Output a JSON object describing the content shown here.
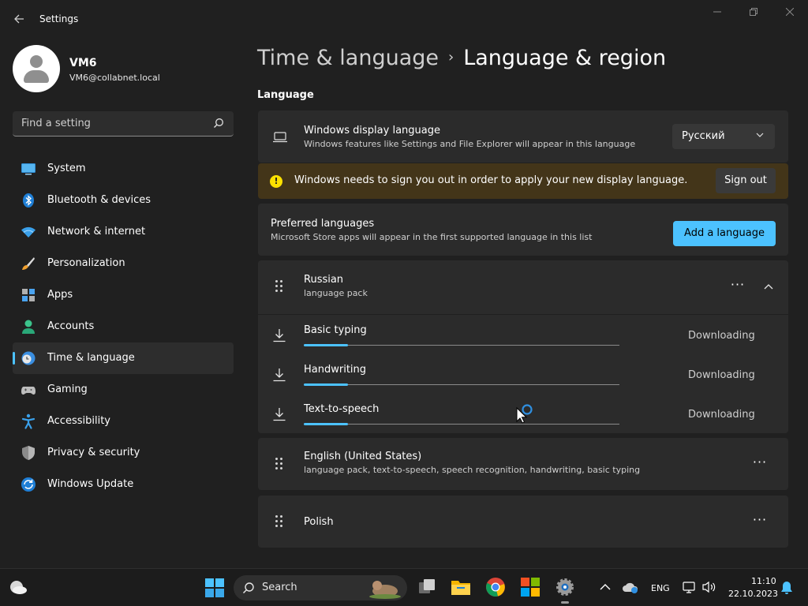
{
  "window": {
    "title": "Settings"
  },
  "profile": {
    "name": "VM6",
    "email": "VM6@collabnet.local"
  },
  "search": {
    "placeholder": "Find a setting"
  },
  "nav": {
    "items": [
      {
        "label": "System",
        "icon": "monitor-icon"
      },
      {
        "label": "Bluetooth & devices",
        "icon": "bluetooth-icon"
      },
      {
        "label": "Network & internet",
        "icon": "wifi-icon"
      },
      {
        "label": "Personalization",
        "icon": "paintbrush-icon"
      },
      {
        "label": "Apps",
        "icon": "apps-icon"
      },
      {
        "label": "Accounts",
        "icon": "person-icon"
      },
      {
        "label": "Time & language",
        "icon": "clock-globe-icon",
        "selected": true
      },
      {
        "label": "Gaming",
        "icon": "gamepad-icon"
      },
      {
        "label": "Accessibility",
        "icon": "accessibility-icon"
      },
      {
        "label": "Privacy & security",
        "icon": "shield-icon"
      },
      {
        "label": "Windows Update",
        "icon": "update-icon"
      }
    ]
  },
  "breadcrumb": {
    "parent": "Time & language",
    "separator": "›",
    "current": "Language & region"
  },
  "language": {
    "section_title": "Language",
    "display_language": {
      "title": "Windows display language",
      "subtitle": "Windows features like Settings and File Explorer will appear in this language",
      "selected": "Русский"
    },
    "warning": {
      "text": "Windows needs to sign you out in order to apply your new display language.",
      "icon_glyph": "!",
      "button": "Sign out"
    },
    "preferred": {
      "title": "Preferred languages",
      "subtitle": "Microsoft Store apps will appear in the first supported language in this list",
      "add_button": "Add a language"
    },
    "languages": [
      {
        "name": "Russian",
        "detail": "language pack",
        "more": "···",
        "expanded": true,
        "features": [
          {
            "label": "Basic typing",
            "status": "Downloading",
            "progress": 0.14
          },
          {
            "label": "Handwriting",
            "status": "Downloading",
            "progress": 0.14
          },
          {
            "label": "Text-to-speech",
            "status": "Downloading",
            "progress": 0.14
          }
        ]
      },
      {
        "name": "English (United States)",
        "detail": "language pack, text-to-speech, speech recognition, handwriting, basic typing",
        "more": "···"
      },
      {
        "name": "Polish",
        "detail": "",
        "more": "···"
      }
    ]
  },
  "taskbar": {
    "search_label": "Search",
    "input_indicator": "ENG",
    "time": "11:10",
    "date": "22.10.2023"
  },
  "colors": {
    "accent": "#4cc2ff",
    "background": "#202020",
    "card": "#2b2b2b",
    "warning_bg": "#433519",
    "warning_icon": "#fce100"
  }
}
